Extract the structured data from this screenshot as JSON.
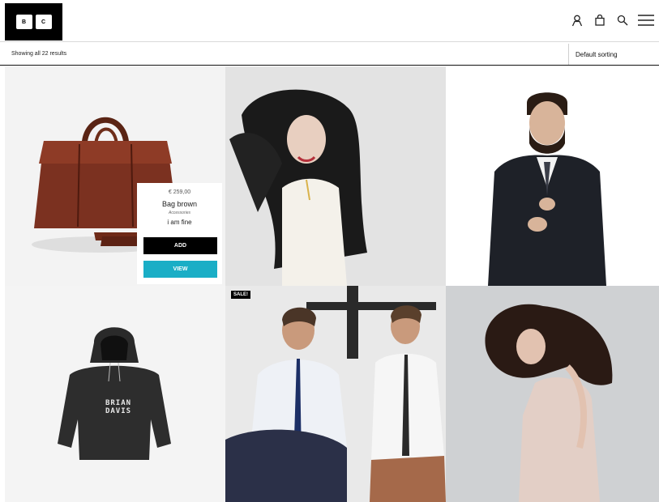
{
  "header": {
    "logo_letters": [
      "B",
      "C"
    ],
    "icons": [
      "user-icon",
      "shopping-bag-icon",
      "search-icon",
      "menu-icon"
    ]
  },
  "toolbar": {
    "result_count": "Showing all 22 results",
    "sort_selected": "Default sorting"
  },
  "products": [
    {
      "image": "brown-leather-bag",
      "card": {
        "price": "€ 259,00",
        "name": "Bag brown",
        "category": "Accessories",
        "description": "i am fine",
        "add_label": "ADD",
        "view_label": "VIEW"
      }
    },
    {
      "image": "woman-dark-hair-white-jacket"
    },
    {
      "image": "bearded-man-suit"
    },
    {
      "image": "black-hoodie",
      "hoodie_print": "BRIAN DAVIS"
    },
    {
      "image": "two-men-shirts-ties",
      "badge": "SALE!"
    },
    {
      "image": "woman-curly-hair-dress"
    }
  ],
  "colors": {
    "accent": "#1aaec6",
    "dark": "#000000"
  }
}
